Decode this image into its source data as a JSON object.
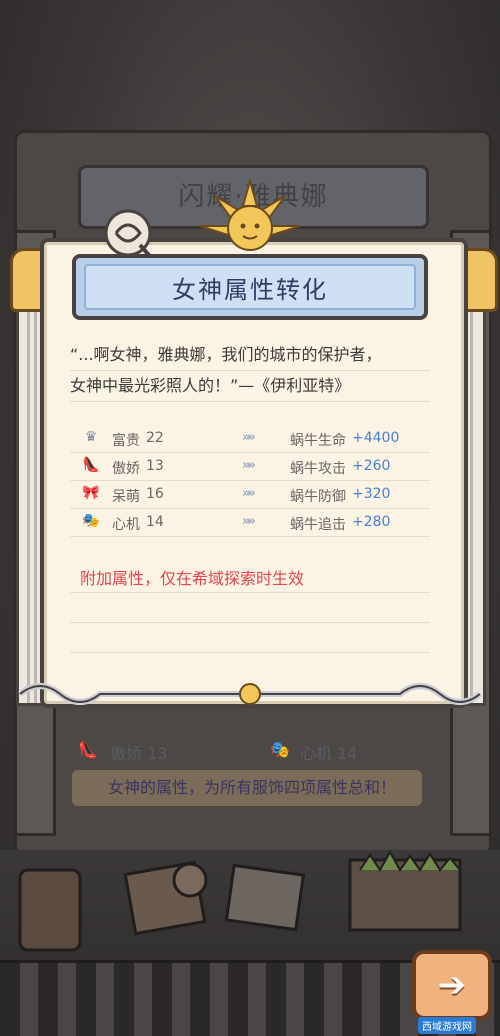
{
  "background": {
    "title_faded": "闪耀·雅典娜",
    "stat_left": "傲娇 13",
    "stat_right": "心机 14",
    "note": "女神的属性，为所有服饰四项属性总和！"
  },
  "dialog": {
    "title": "女神属性转化",
    "quote_line1": "“...啊女神，雅典娜，我们的城市的保护者，",
    "quote_line2": "女神中最光彩照人的！”—《伊利亚特》",
    "stats": [
      {
        "icon": "crown-icon",
        "name": "富贵",
        "value": "22",
        "target": "蜗牛生命",
        "bonus": "+4400"
      },
      {
        "icon": "high-heel-icon",
        "name": "傲娇",
        "value": "13",
        "target": "蜗牛攻击",
        "bonus": "+260"
      },
      {
        "icon": "bow-icon",
        "name": "呆萌",
        "value": "16",
        "target": "蜗牛防御",
        "bonus": "+320"
      },
      {
        "icon": "mask-icon",
        "name": "心机",
        "value": "14",
        "target": "蜗牛追击",
        "bonus": "+280"
      }
    ],
    "warning": "附加属性，仅在希域探索时生效"
  },
  "watermark": "西域游戏网",
  "colors": {
    "accent_blue": "#4b7fd0",
    "warning_red": "#e0464e",
    "title_bar": "#cfe0f4",
    "button_orange": "#f1b27e"
  }
}
